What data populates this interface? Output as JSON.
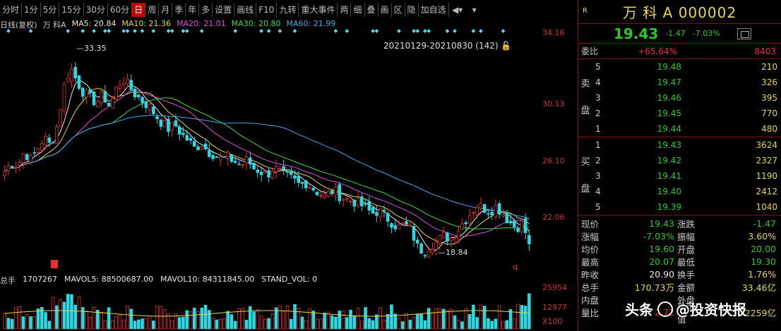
{
  "toolbar": {
    "items": [
      "分时",
      "1分",
      "5分",
      "15分",
      "30分",
      "60分",
      "日",
      "周",
      "月",
      "季",
      "年",
      "多",
      "设置",
      "画线",
      "F10",
      "九转",
      "重大事件",
      "两",
      "细",
      "叠",
      "画",
      "区",
      "隐",
      "加自选"
    ],
    "active": "日"
  },
  "ma_bar": {
    "label": "日线(复权)",
    "stock": "万 科A",
    "ma5": "MA5: 20.84",
    "ma10": "MA10: 21.36",
    "ma20": "MA20: 21.01",
    "ma30": "MA30: 20.80",
    "ma60": "MA60: 21.99"
  },
  "range_label": "20210129-20210830 (142)",
  "price_axis": [
    "34.16",
    "30.13",
    "26.10",
    "22.06"
  ],
  "annotations": {
    "high": "33.35",
    "low": "18.84",
    "q_mark": "q"
  },
  "vol_bar": {
    "label": "总手",
    "vol": "1707267",
    "mavol5": "MAVOL5: 88500687.00",
    "mavol10": "MAVOL10: 84311845.00",
    "stand": "STAND_VOL: 0"
  },
  "vol_axis": [
    "25954",
    "12977",
    "X100"
  ],
  "colors": {
    "up": "#e83030",
    "down": "#2ed8e0",
    "accent": "#e8d84a",
    "green": "#2ec82e",
    "border": "#8a1010"
  },
  "chart_data": {
    "type": "candlestick",
    "title": "",
    "xlabel": "",
    "ylabel": "",
    "ylim": [
      18.0,
      34.5
    ],
    "series": [
      {
        "name": "MA5"
      },
      {
        "name": "MA10"
      },
      {
        "name": "MA20"
      },
      {
        "name": "MA30"
      },
      {
        "name": "MA60"
      }
    ],
    "close_path": [
      24.6,
      25.2,
      25.0,
      26.0,
      25.4,
      26.2,
      27.0,
      26.4,
      27.8,
      30.5,
      32.0,
      31.0,
      30.2,
      29.8,
      29.5,
      30.0,
      29.2,
      30.4,
      31.2,
      30.6,
      30.0,
      29.6,
      29.2,
      28.6,
      28.0,
      27.6,
      27.9,
      27.2,
      26.8,
      26.2,
      26.6,
      26.0,
      25.8,
      25.4,
      25.6,
      25.3,
      25.0,
      25.4,
      24.8,
      24.6,
      24.3,
      24.9,
      24.5,
      24.2,
      24.0,
      23.6,
      23.8,
      23.4,
      23.0,
      22.8,
      23.3,
      22.9,
      22.6,
      22.5,
      22.3,
      22.0,
      21.6,
      21.8,
      21.4,
      21.0,
      20.6,
      20.8,
      20.4,
      19.2,
      18.9,
      19.4,
      19.6,
      20.0,
      19.8,
      20.4,
      21.0,
      21.6,
      22.2,
      22.0,
      21.8,
      22.1,
      21.6,
      21.0,
      20.6,
      20.9,
      19.43
    ]
  },
  "panel": {
    "badge": "R",
    "title": "万 科 A  000002",
    "price": "19.43",
    "change": "-1.47",
    "pct": "-7.03%",
    "ratio": {
      "label": "委比",
      "pct": "+65.64%",
      "diff": "8403"
    },
    "sell_label": [
      "卖",
      "盘"
    ],
    "buy_label": [
      "买",
      "盘"
    ],
    "sell": [
      {
        "lvl": "5",
        "price": "19.48",
        "vol": "210"
      },
      {
        "lvl": "4",
        "price": "19.47",
        "vol": "326"
      },
      {
        "lvl": "3",
        "price": "19.46",
        "vol": "395"
      },
      {
        "lvl": "2",
        "price": "19.45",
        "vol": "770"
      },
      {
        "lvl": "1",
        "price": "19.44",
        "vol": "480"
      }
    ],
    "buy": [
      {
        "lvl": "1",
        "price": "19.43",
        "vol": "3624"
      },
      {
        "lvl": "2",
        "price": "19.42",
        "vol": "2327"
      },
      {
        "lvl": "3",
        "price": "19.41",
        "vol": "1190"
      },
      {
        "lvl": "4",
        "price": "19.40",
        "vol": "2412"
      },
      {
        "lvl": "5",
        "price": "19.39",
        "vol": "1040"
      }
    ],
    "stats": [
      {
        "l1": "现价",
        "v1": "19.43",
        "c1": "green",
        "l2": "涨跌",
        "v2": "-1.47",
        "c2": "green"
      },
      {
        "l1": "涨幅",
        "v1": "-7.03%",
        "c1": "green",
        "l2": "振幅",
        "v2": "3.60%",
        "c2": "yellow"
      },
      {
        "l1": "均价",
        "v1": "19.60",
        "c1": "green",
        "l2": "开盘",
        "v2": "20.00",
        "c2": "green"
      },
      {
        "l1": "最高",
        "v1": "20.07",
        "c1": "green",
        "l2": "最低",
        "v2": "19.30",
        "c2": "green"
      },
      {
        "l1": "昨收",
        "v1": "20.90",
        "c1": "white",
        "l2": "换手",
        "v2": "1.76%",
        "c2": "yellow"
      },
      {
        "l1": "总手",
        "v1": "170.73万",
        "c1": "yellow",
        "l2": "金额",
        "v2": "33.46亿",
        "c2": "yellow"
      },
      {
        "l1": "内盘",
        "v1": "",
        "c1": "green",
        "l2": "外盘",
        "v2": "",
        "c2": "red"
      },
      {
        "l1": "量比",
        "v1": "2.72",
        "c1": "red",
        "l2": "总市值",
        "v2": "2259亿",
        "c2": "yellow"
      }
    ]
  },
  "watermark": {
    "prefix": "头条",
    "text": "@投资快报"
  }
}
